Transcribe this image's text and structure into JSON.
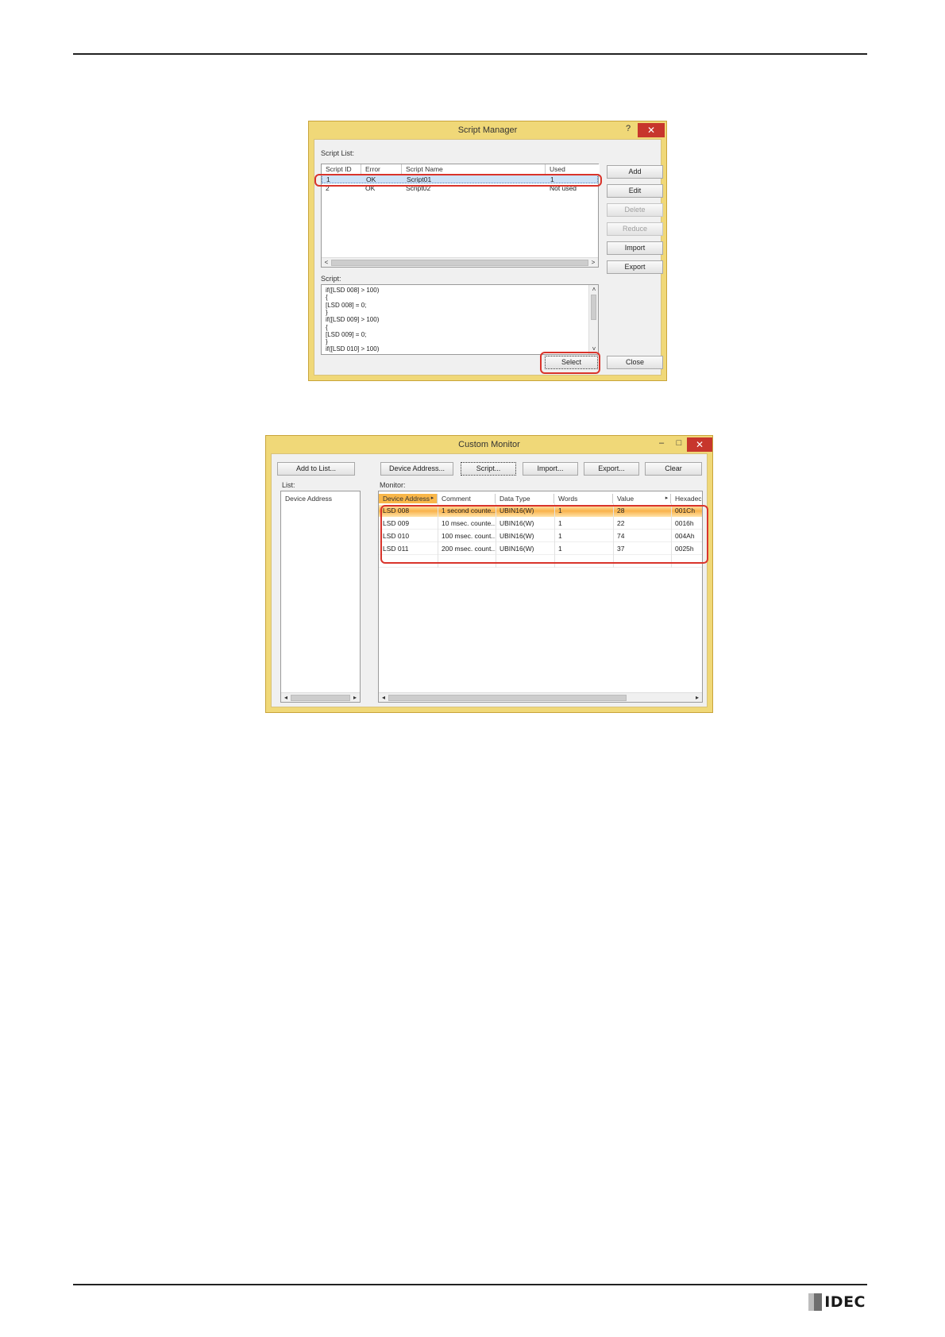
{
  "brand": {
    "logo_text": "IDEC"
  },
  "script_manager": {
    "title": "Script Manager",
    "help_symbol": "?",
    "close_symbol": "✕",
    "script_list_label": "Script List:",
    "columns": [
      "Script ID",
      "Error",
      "Script Name",
      "Used"
    ],
    "rows": [
      [
        "1",
        "OK",
        "Script01",
        "1"
      ],
      [
        "2",
        "OK",
        "Script02",
        "Not used"
      ]
    ],
    "buttons": {
      "add": "Add",
      "edit": "Edit",
      "delete": "Delete",
      "reduce": "Reduce",
      "import": "Import",
      "export": "Export",
      "select": "Select",
      "close": "Close"
    },
    "script_label": "Script:",
    "script_lines": [
      "if([LSD 008] > 100)",
      "{",
      "[LSD 008] = 0;",
      "}",
      "if([LSD 009] > 100)",
      "{",
      "[LSD 009] = 0;",
      "}",
      "if([LSD 010] > 100)"
    ]
  },
  "custom_monitor": {
    "title": "Custom Monitor",
    "min_symbol": "–",
    "max_symbol": "□",
    "close_symbol": "✕",
    "buttons": {
      "add_to_list": "Add to List...",
      "device_address": "Device Address...",
      "script": "Script...",
      "import": "Import...",
      "export": "Export...",
      "clear": "Clear"
    },
    "list_label": "List:",
    "list_header": "Device Address",
    "monitor_label": "Monitor:",
    "columns": [
      "Device Address",
      "Comment",
      "Data Type",
      "Words",
      "Value",
      "Hexadeci"
    ],
    "rows": [
      [
        "LSD 008",
        "1 second counte...",
        "UBIN16(W)",
        "1",
        "28",
        "001Ch"
      ],
      [
        "LSD 009",
        "10 msec. counte...",
        "UBIN16(W)",
        "1",
        "22",
        "0016h"
      ],
      [
        "LSD 010",
        "100 msec. count...",
        "UBIN16(W)",
        "1",
        "74",
        "004Ah"
      ],
      [
        "LSD 011",
        "200 msec. count...",
        "UBIN16(W)",
        "1",
        "37",
        "0025h"
      ]
    ]
  }
}
